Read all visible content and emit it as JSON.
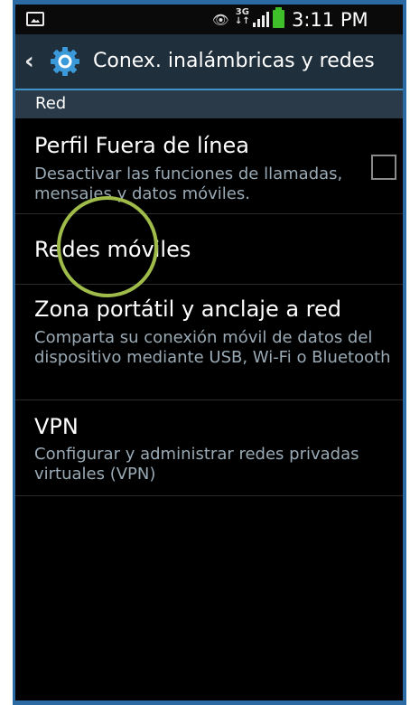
{
  "status_bar": {
    "time": "3:11 PM",
    "network": "3G",
    "icons": [
      "gallery-icon",
      "eye-icon",
      "3g-icon",
      "signal-icon",
      "battery-icon"
    ],
    "battery_color": "#3fbf2a"
  },
  "action_bar": {
    "title": "Conex. inalámbricas y redes",
    "back_icon": "chevron-left-icon",
    "app_icon": "settings-gear-icon"
  },
  "section": {
    "label": "Red"
  },
  "items": [
    {
      "title": "Perfil Fuera de línea",
      "subtitle": "Desactivar las funciones de llamadas, mensajes y datos móviles.",
      "checkbox_checked": false
    },
    {
      "title": "Redes móviles"
    },
    {
      "title": "Zona portátil y anclaje a red",
      "subtitle": "Comparta su conexión móvil de datos del dispositivo mediante USB, Wi-Fi o Bluetooth"
    },
    {
      "title": "VPN",
      "subtitle": "Configurar y administrar redes privadas virtuales (VPN)"
    }
  ],
  "colors": {
    "frame": "#2b6aa3",
    "action_bar": "#1f2f3c",
    "section_header": "#2a3a48",
    "accent_line": "#3f95cb",
    "highlight_circle": "#9fbb4a"
  }
}
